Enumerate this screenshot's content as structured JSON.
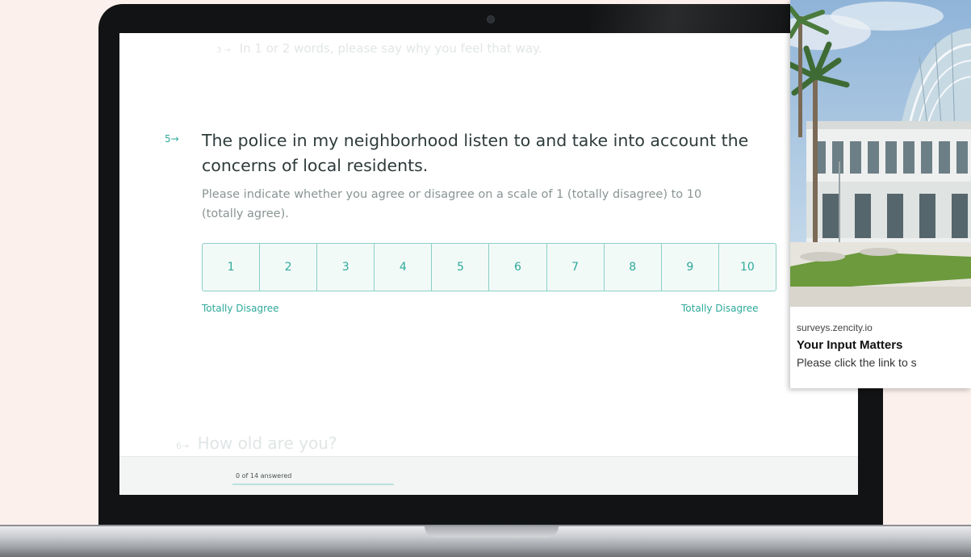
{
  "survey": {
    "prev_question": {
      "number": "3 →",
      "text": "In 1 or 2 words, please say why you feel that way."
    },
    "question": {
      "number": "5→",
      "title": "The police in my neighborhood listen to and take into account the concerns of local residents.",
      "description": "Please indicate whether you agree or disagree on a scale of 1 (totally disagree) to 10 (totally agree).",
      "scale": [
        "1",
        "2",
        "3",
        "4",
        "5",
        "6",
        "7",
        "8",
        "9",
        "10"
      ],
      "label_left": "Totally Disagree",
      "label_right": "Totally Disagree"
    },
    "next_question": {
      "number": "6→",
      "text": "How old are you?"
    },
    "footer": {
      "answered_text": "0 of 14 answered",
      "progress_fraction": 0.0
    }
  },
  "notification": {
    "domain": "surveys.zencity.io",
    "title": "Your Input Matters",
    "text": "Please click the link to s"
  },
  "colors": {
    "accent": "#2ea99a",
    "scale_border": "#8ccfc6",
    "background": "#fcf0ec"
  }
}
